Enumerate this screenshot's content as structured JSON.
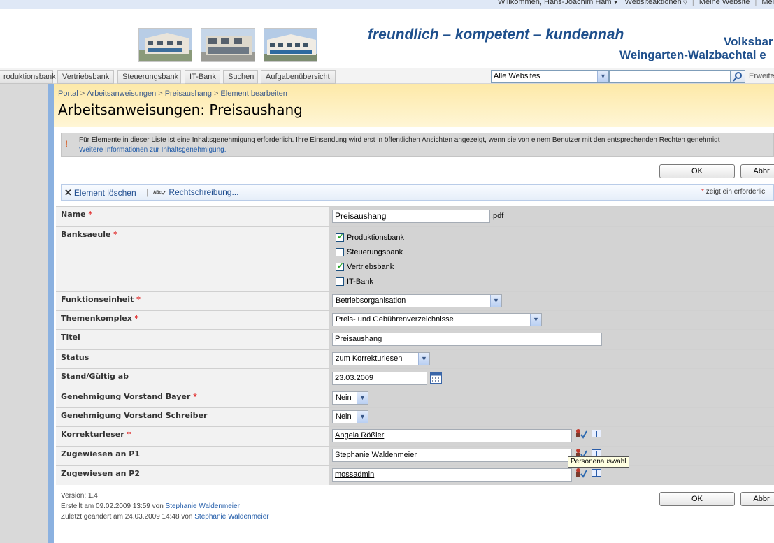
{
  "header": {
    "welcome": "Willkommen, Hans-Joachim Ham",
    "site_actions": "Websiteaktionen",
    "my_site": "Meine Website",
    "my_links": "Meine L",
    "tagline": "freundlich – kompetent – kundennah",
    "bank_line1": "Volksbar",
    "bank_line2": "Weingarten-Walzbachtal e"
  },
  "nav": {
    "tabs": [
      "roduktionsbank",
      "Vertriebsbank",
      "Steuerungsbank",
      "IT-Bank",
      "Suchen",
      "Aufgabenübersicht"
    ],
    "scope": "Alle Websites",
    "search_value": "",
    "advanced": "Erweite"
  },
  "breadcrumb": [
    "Portal",
    "Arbeitsanweisungen",
    "Preisaushang",
    "Element bearbeiten"
  ],
  "page_title": "Arbeitsanweisungen: Preisaushang",
  "info": {
    "text": "Für Elemente in dieser Liste ist eine Inhaltsgenehmigung erforderlich. Ihre Einsendung wird erst in öffentlichen Ansichten angezeigt, wenn sie von einem Benutzer mit den entsprechenden Rechten genehmigt",
    "link": "Weitere Informationen zur Inhaltsgenehmigung."
  },
  "buttons": {
    "ok": "OK",
    "cancel": "Abbr"
  },
  "toolbar": {
    "delete": "Element löschen",
    "spell": "Rechtschreibung...",
    "required_note": "zeigt ein erforderlic"
  },
  "form": {
    "name": {
      "label": "Name",
      "value": "Preisaushang",
      "suffix": ".pdf"
    },
    "banksaeule": {
      "label": "Banksaeule",
      "options": [
        {
          "label": "Produktionsbank",
          "checked": true
        },
        {
          "label": "Steuerungsbank",
          "checked": false
        },
        {
          "label": "Vertriebsbank",
          "checked": true
        },
        {
          "label": "IT-Bank",
          "checked": false
        }
      ]
    },
    "funktionseinheit": {
      "label": "Funktionseinheit",
      "value": "Betriebsorganisation"
    },
    "themenkomplex": {
      "label": "Themenkomplex",
      "value": "Preis- und Gebührenverzeichnisse"
    },
    "titel": {
      "label": "Titel",
      "value": "Preisaushang"
    },
    "status": {
      "label": "Status",
      "value": "zum Korrekturlesen"
    },
    "stand": {
      "label": "Stand/Gültig ab",
      "value": "23.03.2009"
    },
    "gen_bayer": {
      "label": "Genehmigung Vorstand Bayer",
      "value": "Nein"
    },
    "gen_schreiber": {
      "label": "Genehmigung Vorstand Schreiber",
      "value": "Nein"
    },
    "korrekturleser": {
      "label": "Korrekturleser",
      "value": "Angela Rößler"
    },
    "p1": {
      "label": "Zugewiesen an P1",
      "value": "Stephanie Waldenmeier"
    },
    "p2": {
      "label": "Zugewiesen an P2",
      "value": "mossadmin"
    }
  },
  "tooltip": "Personenauswahl",
  "footer": {
    "version": "Version: 1.4",
    "created_prefix": "Erstellt am 09.02.2009 13:59  von",
    "created_by": "Stephanie Waldenmeier",
    "modified_prefix": "Zuletzt geändert am 24.03.2009 14:48  von",
    "modified_by": "Stephanie Waldenmeier"
  }
}
